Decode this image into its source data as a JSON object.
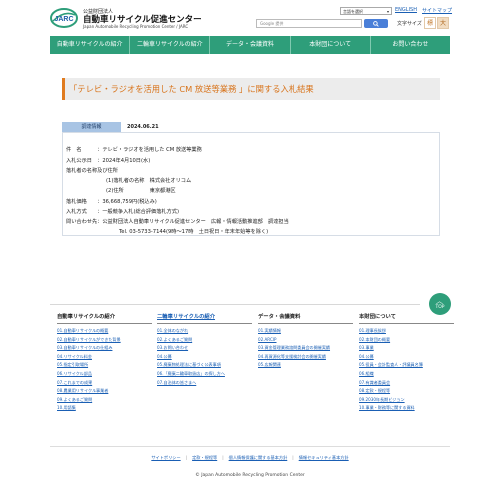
{
  "header": {
    "logo_text": "JARC",
    "org_kind": "公益財団法人",
    "org_name": "自動車リサイクル促進センター",
    "org_name_en": "Japan Automobile Recycling Promotion Center / JARC",
    "language_select": "言語を選択",
    "english_link": "ENGLISH",
    "sitemap_link": "サイトマップ",
    "search_placeholder": "Google 提供",
    "font_size_label": "文字サイズ",
    "font_normal": "標",
    "font_large": "大",
    "icons": [
      "jarc-logo-icon",
      "search-icon"
    ]
  },
  "nav": [
    {
      "label": "自動車リサイクルの紹介"
    },
    {
      "label": "二輪車リサイクルの紹介"
    },
    {
      "label": "データ・会議資料"
    },
    {
      "label": "本財団について"
    },
    {
      "label": "お問い合わせ"
    }
  ],
  "page": {
    "title": "「テレビ・ラジオを活用した CM 放送等業務 」に関する入札結果",
    "category": "調達情報",
    "date": "2024.06.21",
    "accent_color": "#d8731a",
    "brand_color": "#2e9e7a"
  },
  "details": [
    "件　名　　　：テレビ・ラジオを活用した CM 放送等業務",
    "入札公示日　：2024年4月10日(水)",
    "落札者の名称及び住所",
    "(1)落札者の名称　株式会社オリコム",
    "(2)住所　　　　　東京都港区",
    "落札価格　　：36,668,759円(税込み)",
    "入札方式　　：一般競争入札(総合評価落札方式)",
    "問い合わせ先：公益財団法人自動車リサイクル促進センター　広報・情報活動推進部　調達担当",
    "Tel. 03-5733-7144(9時～17時　土日祝日・年末年始等を除く)"
  ],
  "top_button": {
    "label": "TOP"
  },
  "footer": {
    "columns": [
      {
        "heading": "自動車リサイクルの紹介",
        "links": [
          "01.自動車リサイクルの概要",
          "02.自動車リサイクルができた背景",
          "03.自動車リサイクルの仕組み",
          "04.リサイクル料金",
          "05.指定引取場所",
          "06.リサイクル部品",
          "07.これまでの成果",
          "08.農業用リサイクル事業者",
          "09.よくあるご質問",
          "10.用語集"
        ]
      },
      {
        "heading": "二輪車リサイクルの紹介",
        "links": [
          "01.全体のながれ",
          "02.よくあるご質問",
          "03.お問い合わせ",
          "04.公募",
          "05.廃棄物処理法に基づく公表事項",
          "06.「廃棄二輪車取扱店」の探し方へ",
          "07.自治体の皆さまへ"
        ]
      },
      {
        "heading": "データ・会議資料",
        "links": [
          "01.実績情報",
          "02.ARCIP",
          "03.資金管理業務諮問委員会の開催実績",
          "04.再資源化等支援検討会の開催実績",
          "05.広報関連"
        ]
      },
      {
        "heading": "本財団について",
        "links": [
          "01.理事長挨拶",
          "02.本財団の概要",
          "03.事業",
          "04.公募",
          "05.役員・会計監査人・評議員名簿",
          "06.組織",
          "07.有識者委員会",
          "08.定款・規程等",
          "09.2030年長期ビジョン",
          "10.事業・財務等に関する資料"
        ]
      }
    ],
    "bottom_links": [
      "サイトポリシー",
      "定款・規程等",
      "個人情報保護に関する基本方針",
      "情報セキュリティ基本方針"
    ],
    "copyright": "© Japan Automobile Recycling Promotion Center"
  }
}
